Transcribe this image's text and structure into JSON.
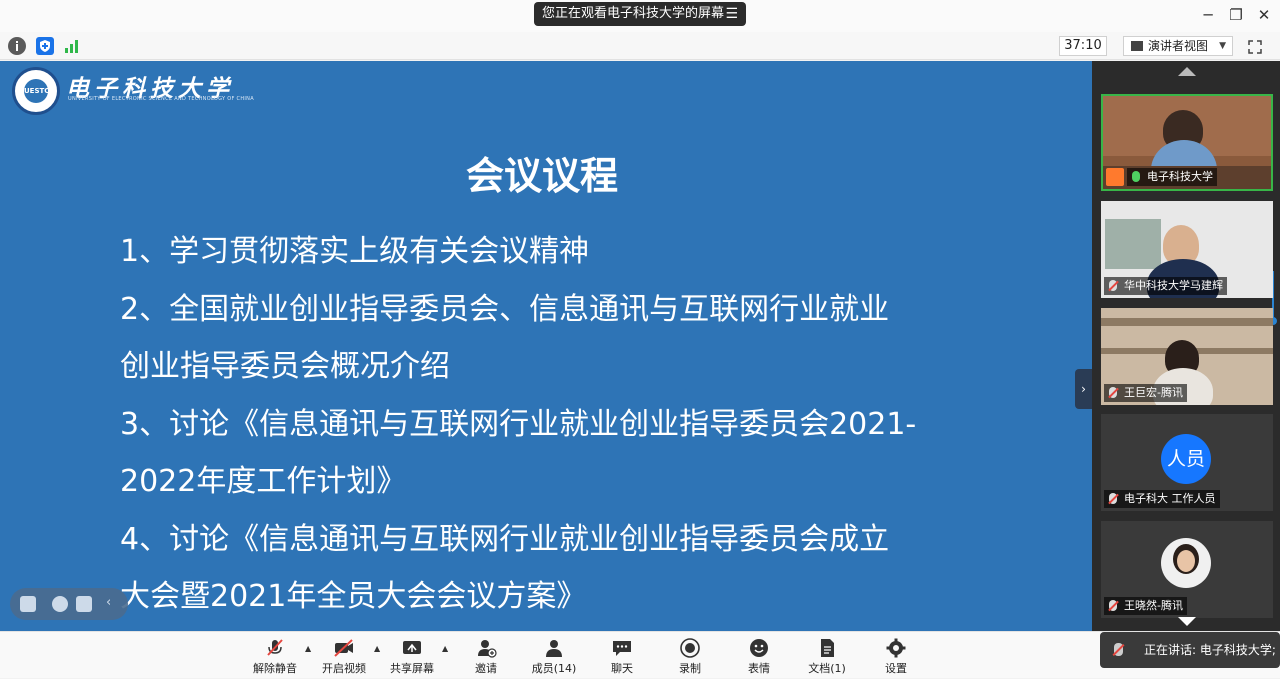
{
  "window": {
    "share_banner": "您正在观看电子科技大学的屏幕",
    "menu_icon": "menu-icon",
    "controls": [
      "minimize-icon",
      "maximize-icon",
      "close-icon"
    ]
  },
  "toolbar": {
    "timer": "37:10",
    "view_mode": "演讲者视图",
    "icons": [
      "info-icon",
      "shield-icon",
      "signal-icon",
      "fullscreen-icon"
    ]
  },
  "slide": {
    "logo_cn": "电子科技大学",
    "logo_en": "UNIVERSITY OF ELECTRONIC SCIENCE AND TECHNOLOGY OF CHINA",
    "logo_badge": "UESTC",
    "title": "会议议程",
    "lines": [
      "1、学习贯彻落实上级有关会议精神",
      "2、全国就业创业指导委员会、信息通讯与互联网行业就业",
      "创业指导委员会概况介绍",
      "3、讨论《信息通讯与互联网行业就业创业指导委员会2021-",
      "2022年度工作计划》",
      "4、讨论《信息通讯与互联网行业就业创业指导委员会成立",
      "大会暨2021年全员大会会议方案》"
    ]
  },
  "participants": [
    {
      "name": "电子科技大学",
      "muted": false,
      "active": true
    },
    {
      "name": "华中科技大学马建辉",
      "muted": true,
      "active": false
    },
    {
      "name": "王巨宏-腾讯",
      "muted": true,
      "active": false
    },
    {
      "name": "电子科大 工作人员",
      "muted": true,
      "active": false,
      "avatar_text": "人员"
    },
    {
      "name": "王晓然-腾讯",
      "muted": true,
      "active": false
    }
  ],
  "bottom_bar": {
    "unmute": "解除静音",
    "video": "开启视频",
    "share": "共享屏幕",
    "invite": "邀请",
    "members": "成员(14)",
    "chat": "聊天",
    "record": "录制",
    "reaction": "表情",
    "docs": "文档(1)",
    "settings": "设置"
  },
  "speaking": "正在讲话: 电子科技大学;",
  "colors": {
    "slide_bg": "#2e74b6",
    "panel_bg": "#2b2b2b",
    "active_border": "#38b548",
    "muted_red": "#e5463f",
    "avatar_blue": "#1677ff"
  }
}
